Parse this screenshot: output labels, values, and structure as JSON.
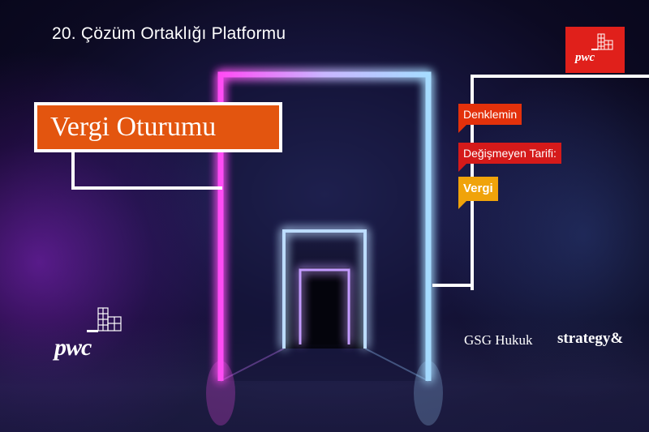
{
  "event_title": "20. Çözüm Ortaklığı Platformu",
  "session_title": "Vergi Oturumu",
  "tags": [
    "Denklemin",
    "Değişmeyen Tarifi:",
    "Vergi"
  ],
  "logos": {
    "pwc_top": "pwc",
    "pwc_bottom": "pwc",
    "gsg": "GSG Hukuk",
    "strategy": "strategy&"
  },
  "colors": {
    "session_orange": "#e3550f",
    "tag1": "#e3310b",
    "tag2": "#d51a1a",
    "tag3": "#f0a30a",
    "pwc_red": "#e0201b",
    "neon_pink": "#ff3df2",
    "neon_blue": "#9fd0ff"
  }
}
